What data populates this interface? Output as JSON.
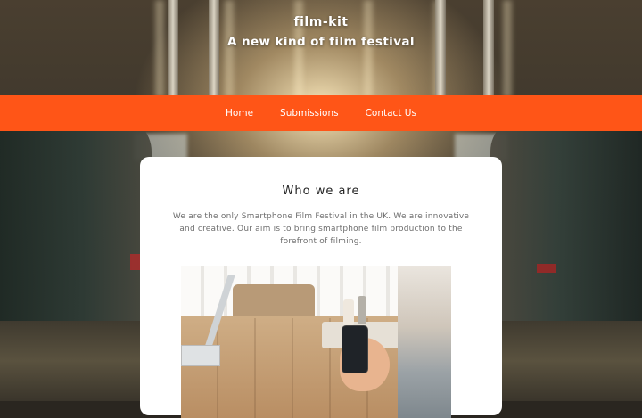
{
  "header": {
    "brand": "film-kit",
    "tagline": "A new kind of film festival"
  },
  "nav": {
    "items": [
      {
        "label": "Home"
      },
      {
        "label": "Submissions"
      },
      {
        "label": "Contact Us"
      }
    ]
  },
  "main": {
    "title": "Who we are",
    "body": "We are the only Smartphone Film Festival in the UK. We are innovative and creative. Our aim is to bring smartphone film production to the forefront of filming."
  },
  "colors": {
    "nav_background": "#ff5517",
    "card_background": "#ffffff",
    "header_text": "#ffffff"
  }
}
